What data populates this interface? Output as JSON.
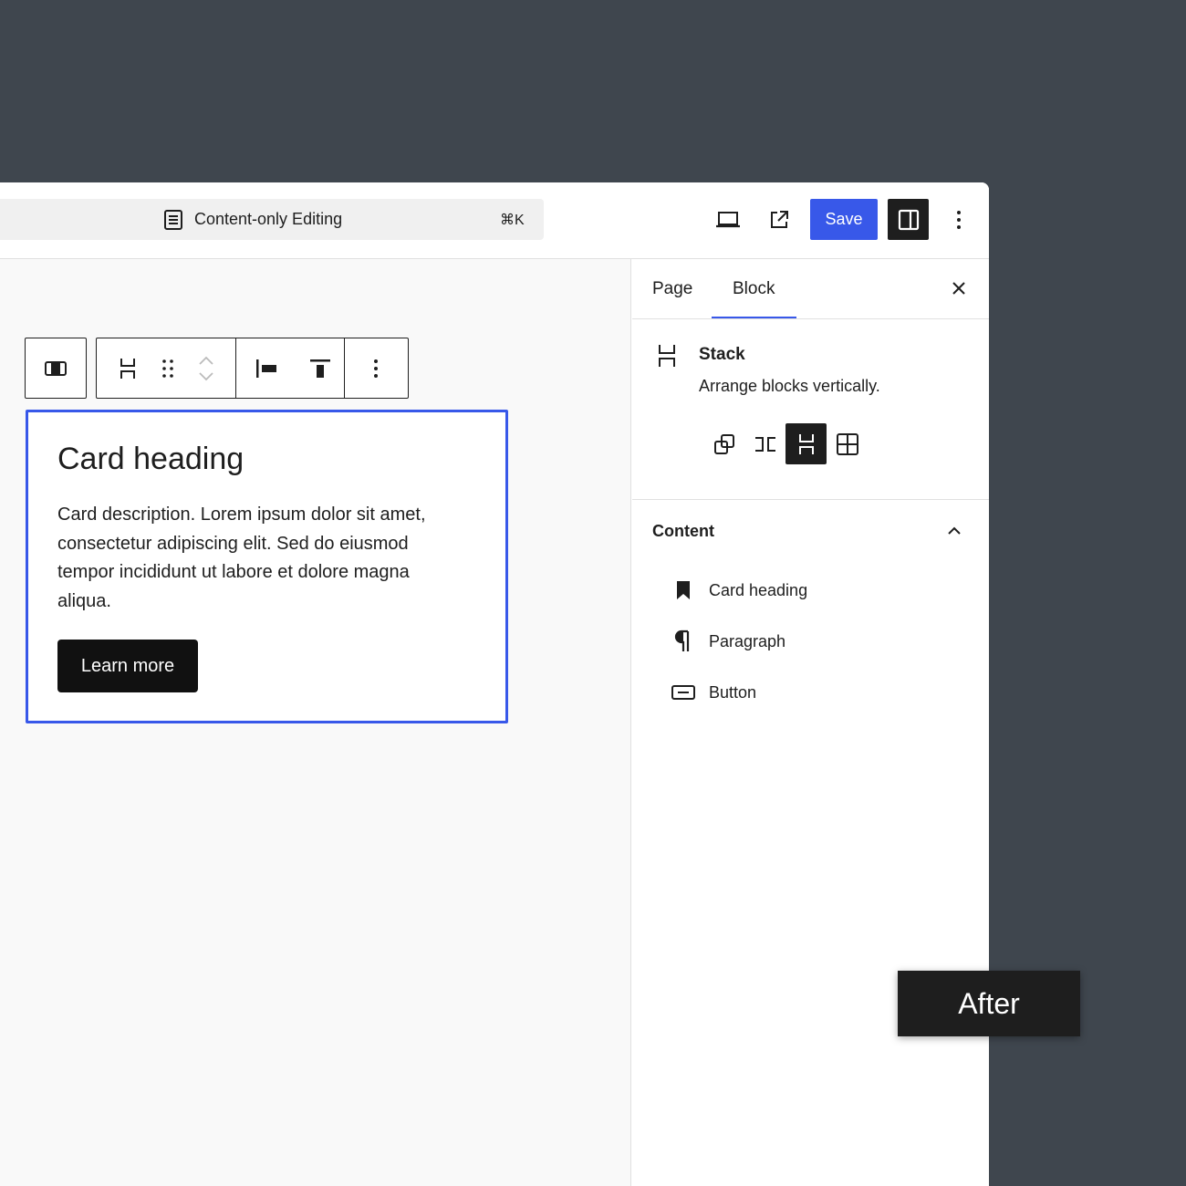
{
  "header": {
    "command_title": "Content-only Editing",
    "command_shortcut": "⌘K",
    "save_label": "Save",
    "icons": [
      "document-icon",
      "desktop-preview-icon",
      "external-view-icon",
      "sidebar-icon",
      "more-vertical-icon"
    ]
  },
  "toolbar": {
    "icons": [
      "block-parent-icon",
      "stack-icon",
      "drag-handle-icon",
      "move-up-icon",
      "move-down-icon",
      "justify-left-icon",
      "align-top-icon",
      "more-vertical-icon"
    ]
  },
  "card": {
    "heading": "Card heading",
    "description": "Card description. Lorem ipsum dolor sit amet, consectetur adipiscing elit. Sed do eiusmod tempor incididunt ut labore et dolore magna aliqua.",
    "button_label": "Learn more"
  },
  "sidebar": {
    "tabs": [
      {
        "label": "Page",
        "active": false
      },
      {
        "label": "Block",
        "active": true
      }
    ],
    "block": {
      "title": "Stack",
      "description": "Arrange blocks vertically.",
      "variations": [
        "group",
        "row",
        "stack",
        "grid"
      ],
      "active_variation": "stack"
    },
    "content_panel": {
      "title": "Content",
      "expanded": true,
      "items": [
        {
          "label": "Card heading",
          "icon": "bookmark-icon"
        },
        {
          "label": "Paragraph",
          "icon": "paragraph-icon"
        },
        {
          "label": "Button",
          "icon": "button-icon"
        }
      ]
    }
  },
  "badge": {
    "label": "After"
  },
  "colors": {
    "accent": "#3858e9",
    "backdrop": "#3f464e",
    "dark": "#1e1e1e"
  }
}
